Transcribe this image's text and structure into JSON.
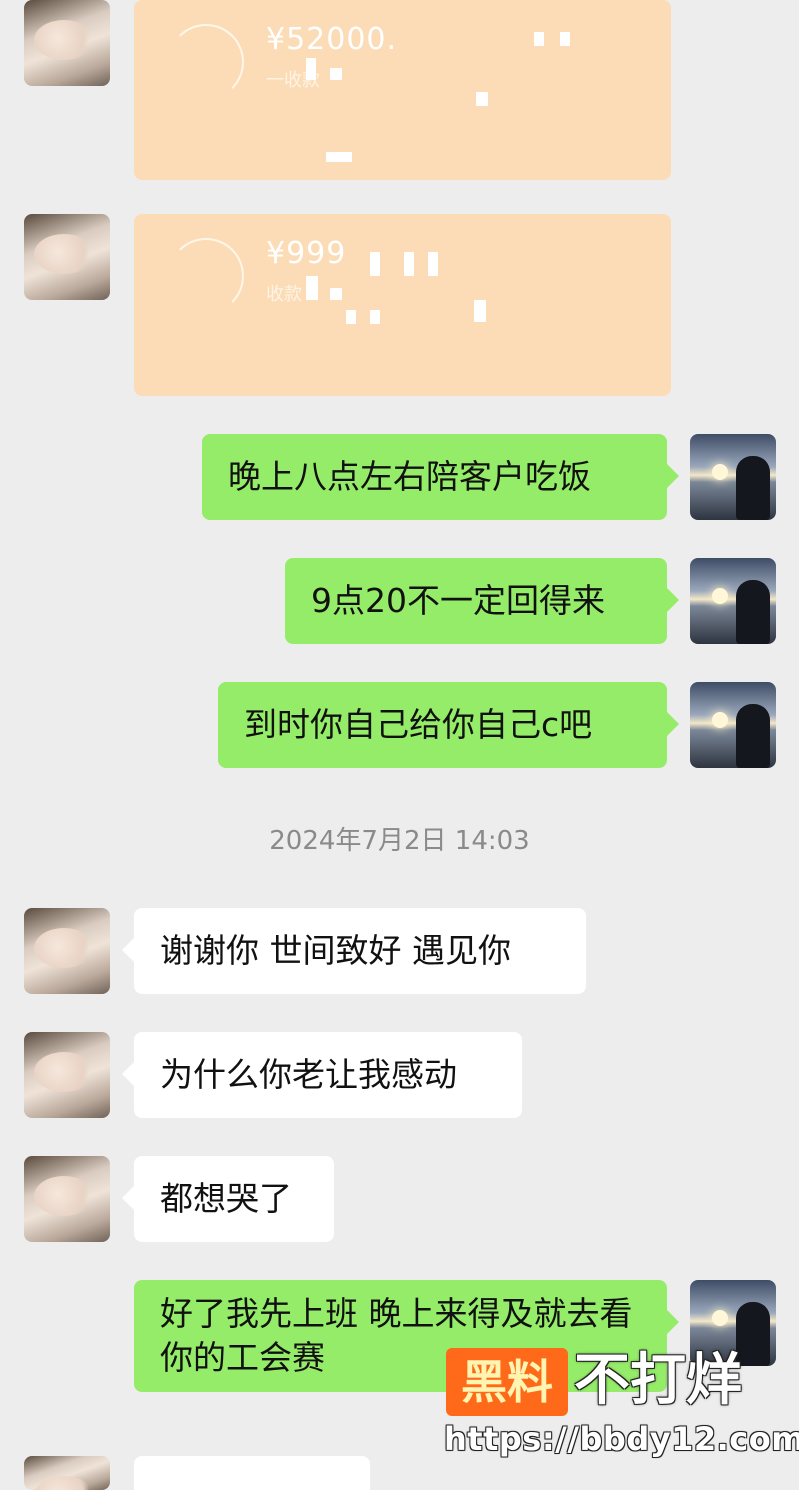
{
  "transfers": [
    {
      "amount": "¥52000.",
      "sub": "一收款"
    },
    {
      "amount": "¥999",
      "sub": "收款"
    }
  ],
  "messages": [
    {
      "side": "right",
      "text": "晚上八点左右陪客户吃饭"
    },
    {
      "side": "right",
      "text": "9点20不一定回得来"
    },
    {
      "side": "right",
      "text": "到时你自己给你自己c吧"
    },
    {
      "side": "left",
      "text": "谢谢你 世间致好 遇见你"
    },
    {
      "side": "left",
      "text": "为什么你老让我感动"
    },
    {
      "side": "left",
      "text": "都想哭了"
    },
    {
      "side": "right",
      "text": "好了我先上班 晚上来得及就去看你的工会赛"
    }
  ],
  "timestamp": "2024年7月2日 14:03",
  "watermark": {
    "box_text": "黑料",
    "text": "不打烊",
    "url": "https://bbdy12.com",
    "accent": "#ff6a1a"
  },
  "colors": {
    "background": "#ededed",
    "sent_bubble": "#95ec69",
    "received_bubble": "#ffffff",
    "transfer_card": "#fbdcb7"
  }
}
